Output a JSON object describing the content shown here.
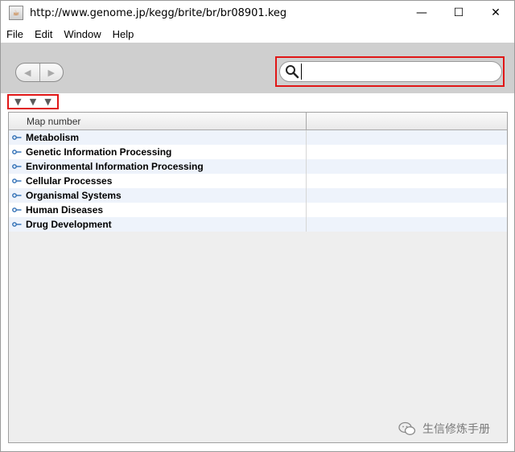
{
  "window": {
    "title": "http://www.genome.jp/kegg/brite/br/br08901.keg",
    "minimize": "—",
    "maximize": "☐",
    "close": "✕"
  },
  "menu": [
    "File",
    "Edit",
    "Window",
    "Help"
  ],
  "toolbar": {
    "back": "◀",
    "forward": "▶",
    "search_value": ""
  },
  "tree_controls": [
    "▼",
    "▼",
    "▼"
  ],
  "table": {
    "columns": [
      "Map number",
      ""
    ],
    "rows": [
      "Metabolism",
      "Genetic Information Processing",
      "Environmental Information Processing",
      "Cellular Processes",
      "Organismal Systems",
      "Human Diseases",
      "Drug Development"
    ]
  },
  "watermark": {
    "text": "生信修炼手册"
  },
  "colors": {
    "highlight": "#e01616",
    "row_alt": "#eef3fb",
    "toolbar": "#cfcfcf"
  }
}
